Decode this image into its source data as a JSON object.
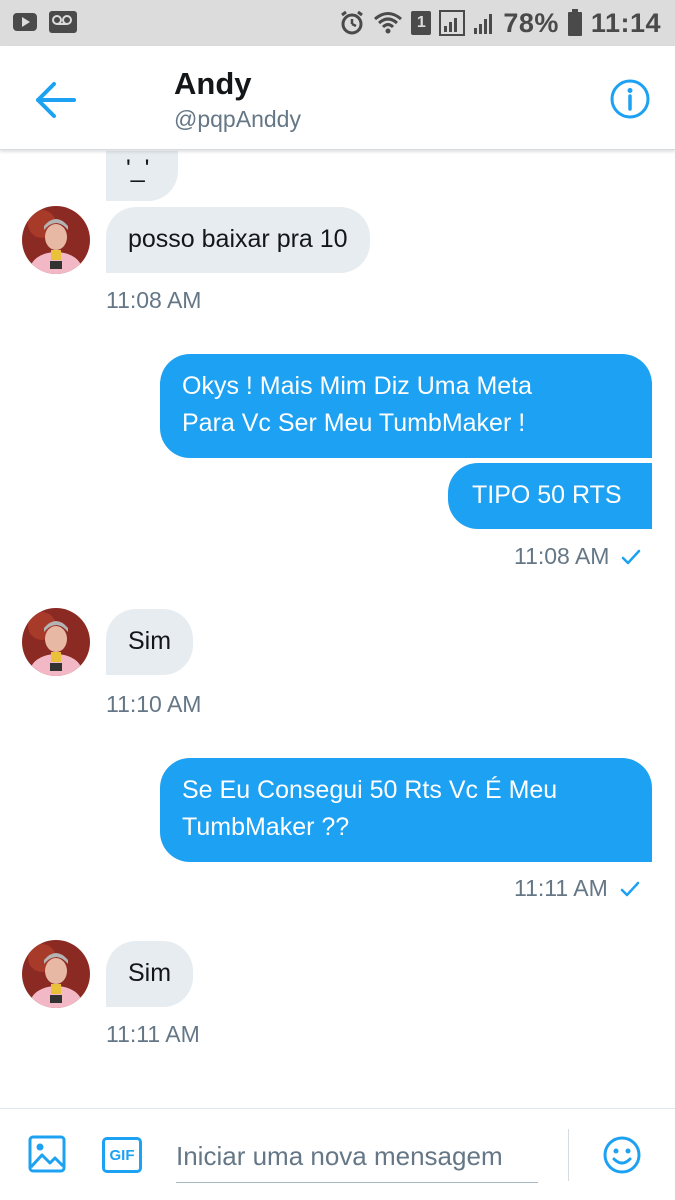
{
  "status_bar": {
    "battery": "78%",
    "time": "11:14",
    "notification_badge": "1"
  },
  "header": {
    "name": "Andy",
    "handle": "@pqpAnddy"
  },
  "messages": [
    {
      "direction": "incoming",
      "text": "'_'"
    },
    {
      "direction": "incoming",
      "text": "posso baixar pra 10"
    },
    {
      "direction": "incoming_time",
      "text": "11:08 AM"
    },
    {
      "direction": "outgoing",
      "lines": [
        "Okys ! Mais Mim Diz Uma Meta",
        "Para Vc Ser Meu TumbMaker !"
      ]
    },
    {
      "direction": "outgoing",
      "text": "TIPO 50 RTS"
    },
    {
      "direction": "outgoing_time",
      "text": "11:08 AM"
    },
    {
      "direction": "incoming",
      "text": "Sim"
    },
    {
      "direction": "incoming_time",
      "text": "11:10 AM"
    },
    {
      "direction": "outgoing",
      "lines": [
        "Se Eu Consegui 50 Rts Vc É Meu",
        "TumbMaker ??"
      ]
    },
    {
      "direction": "outgoing_time",
      "text": "11:11 AM"
    },
    {
      "direction": "incoming",
      "text": "Sim"
    },
    {
      "direction": "incoming_time",
      "text": "11:11 AM"
    }
  ],
  "composer": {
    "placeholder": "Iniciar uma nova mensagem",
    "gif_label": "GIF"
  },
  "colors": {
    "accent": "#1da1f2",
    "incoming_bubble": "#e6ecf0",
    "secondary_text": "#657786"
  }
}
